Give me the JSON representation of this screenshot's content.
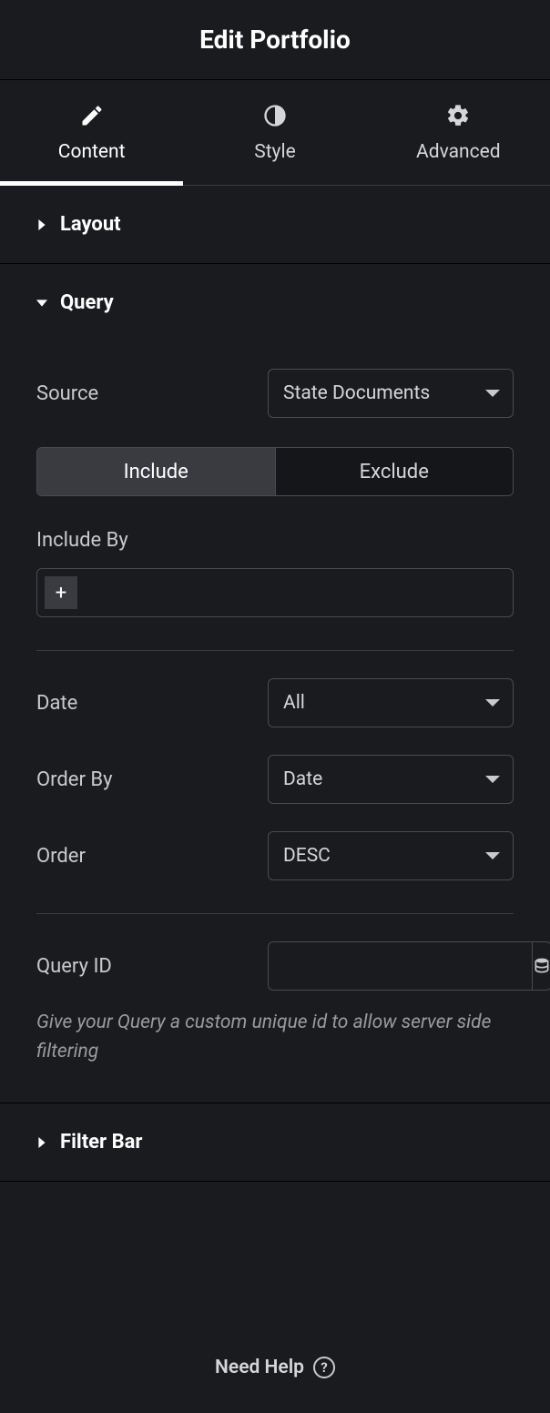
{
  "header": {
    "title": "Edit Portfolio"
  },
  "tabs": {
    "content": "Content",
    "style": "Style",
    "advanced": "Advanced"
  },
  "sections": {
    "layout": {
      "title": "Layout"
    },
    "query": {
      "title": "Query",
      "source_label": "Source",
      "source_value": "State Documents",
      "include_label": "Include",
      "exclude_label": "Exclude",
      "include_by_label": "Include By",
      "date_label": "Date",
      "date_value": "All",
      "orderby_label": "Order By",
      "orderby_value": "Date",
      "order_label": "Order",
      "order_value": "DESC",
      "queryid_label": "Query ID",
      "queryid_value": "",
      "queryid_helper": "Give your Query a custom unique id to allow server side filtering"
    },
    "filterbar": {
      "title": "Filter Bar"
    }
  },
  "footer": {
    "help": "Need Help"
  }
}
